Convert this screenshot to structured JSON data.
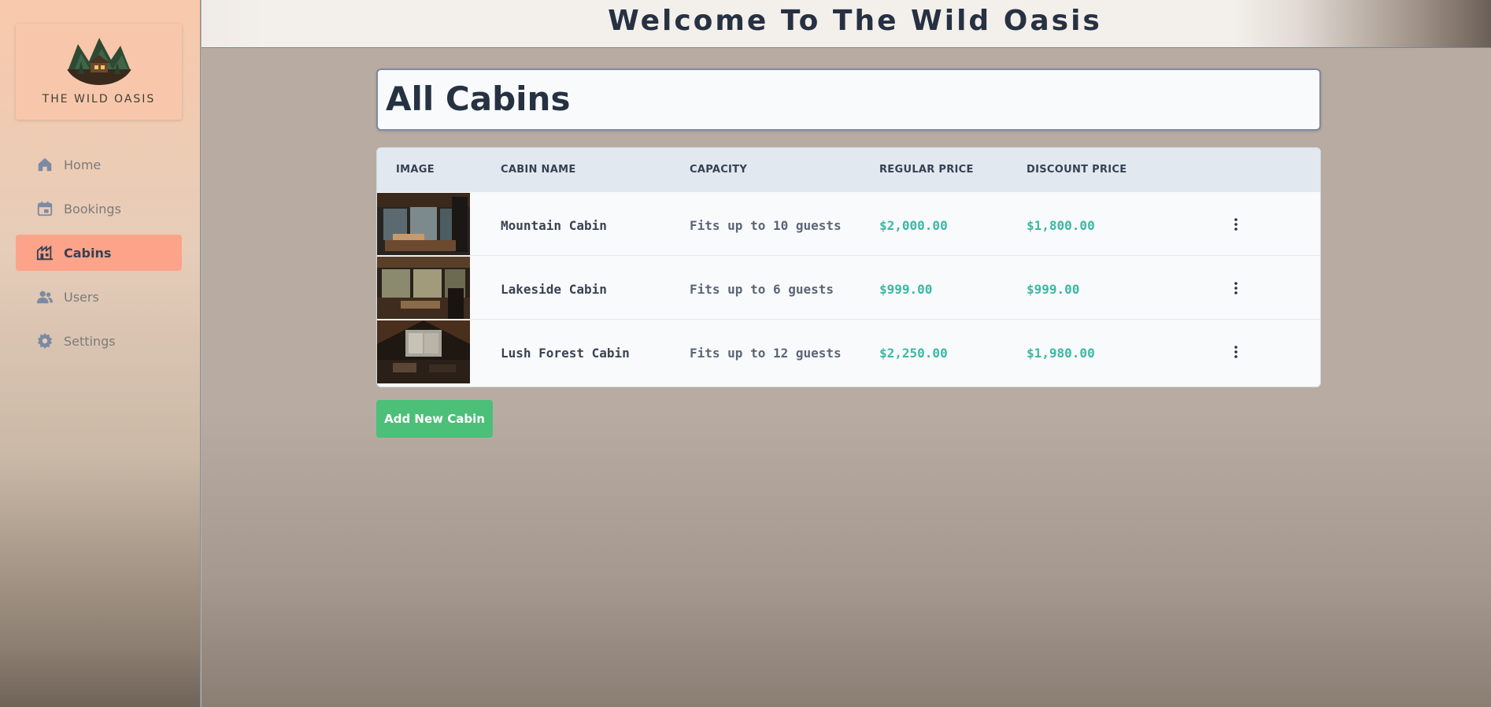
{
  "app": {
    "logo_text": "THE WILD OASIS",
    "header_title": "Welcome To The Wild Oasis"
  },
  "sidebar": {
    "items": [
      {
        "label": "Home",
        "icon": "home-icon",
        "active": false
      },
      {
        "label": "Bookings",
        "icon": "calendar-icon",
        "active": false
      },
      {
        "label": "Cabins",
        "icon": "cabin-icon",
        "active": true
      },
      {
        "label": "Users",
        "icon": "users-icon",
        "active": false
      },
      {
        "label": "Settings",
        "icon": "gear-icon",
        "active": false
      }
    ]
  },
  "main": {
    "title": "All Cabins",
    "table": {
      "columns": [
        "IMAGE",
        "CABIN NAME",
        "CAPACITY",
        "REGULAR PRICE",
        "DISCOUNT PRICE"
      ],
      "rows": [
        {
          "name": "Mountain Cabin",
          "capacity": "Fits up to 10 guests",
          "regular_price": "$2,000.00",
          "discount_price": "$1,800.00"
        },
        {
          "name": "Lakeside Cabin",
          "capacity": "Fits up to 6 guests",
          "regular_price": "$999.00",
          "discount_price": "$999.00"
        },
        {
          "name": "Lush Forest Cabin",
          "capacity": "Fits up to 12 guests",
          "regular_price": "$2,250.00",
          "discount_price": "$1,980.00"
        }
      ]
    },
    "add_button_label": "Add New Cabin"
  },
  "colors": {
    "accent_active_nav": "#fca38a",
    "price_green": "#3db7a4",
    "add_button": "#4cbf78",
    "heading_text": "#263142"
  }
}
